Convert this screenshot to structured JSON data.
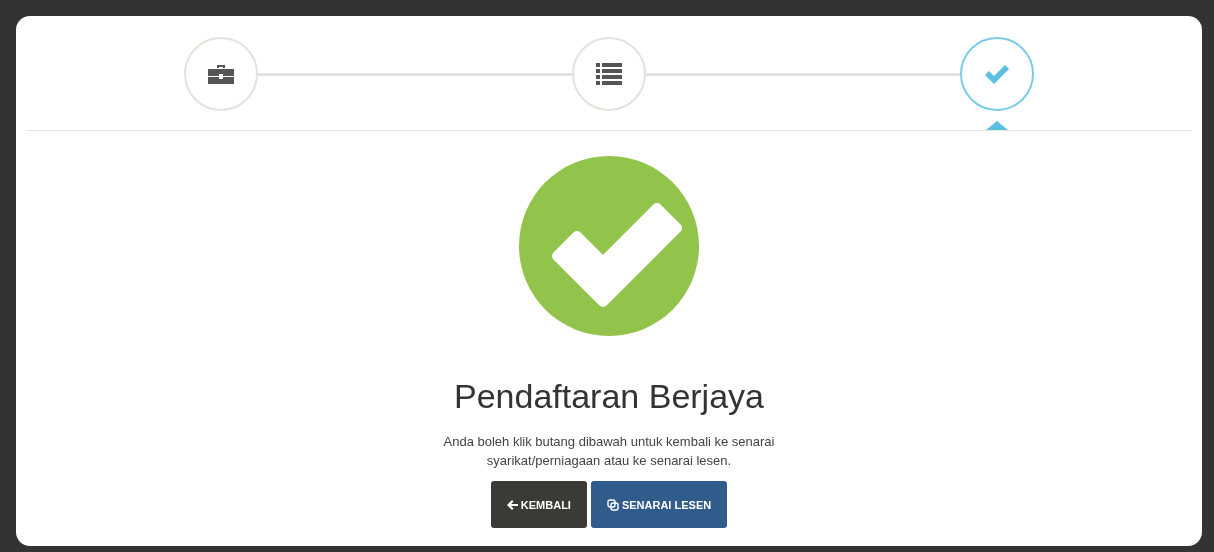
{
  "steps": [
    {
      "kind": "briefcase",
      "selected": false
    },
    {
      "kind": "list",
      "selected": false
    },
    {
      "kind": "check",
      "selected": true
    }
  ],
  "result": {
    "title": "Pendaftaran Berjaya",
    "message": "Anda boleh klik butang dibawah untuk kembali ke senarai syarikat/perniagaan atau ke senarai lesen."
  },
  "buttons": [
    {
      "kind": "back",
      "label": "KEMBALI"
    },
    {
      "kind": "list",
      "label": "SENARAI LESEN"
    }
  ]
}
